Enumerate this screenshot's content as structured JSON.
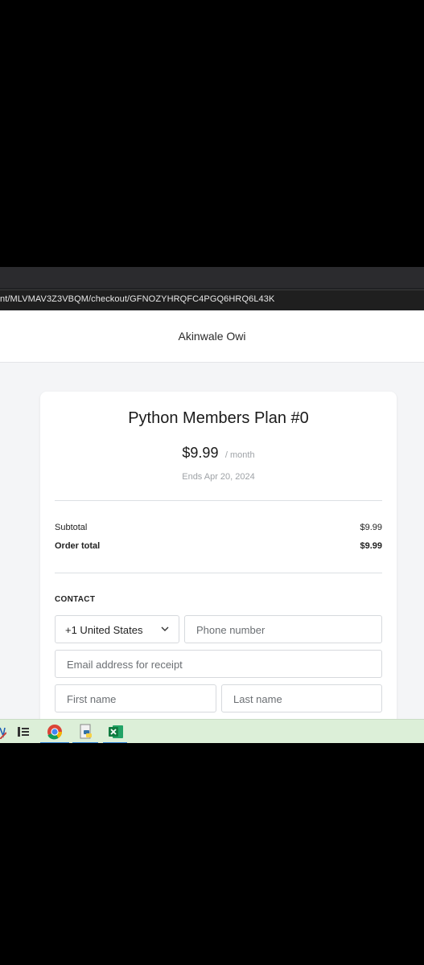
{
  "browser": {
    "url": "nt/MLVMAV3Z3VBQM/checkout/GFNOZYHRQFC4PGQ6HRQ6L43K"
  },
  "header": {
    "merchant_name": "Akinwale Owi"
  },
  "plan": {
    "title": "Python Members Plan #0",
    "price": "$9.99",
    "period": "/ month",
    "ends": "Ends Apr 20, 2024"
  },
  "summary": {
    "subtotal_label": "Subtotal",
    "subtotal_value": "$9.99",
    "total_label": "Order total",
    "total_value": "$9.99"
  },
  "contact": {
    "heading": "CONTACT",
    "country_code": "+1 United States",
    "phone_placeholder": "Phone number",
    "email_placeholder": "Email address for receipt",
    "first_name_placeholder": "First name",
    "last_name_placeholder": "Last name"
  },
  "taskbar": {
    "icons": [
      "task-view-icon",
      "chrome-icon",
      "python-file-icon",
      "excel-icon"
    ]
  },
  "colors": {
    "taskbar_bg": "#dcefd8",
    "page_bg": "#f4f5f7",
    "border": "#d6d9dd"
  }
}
